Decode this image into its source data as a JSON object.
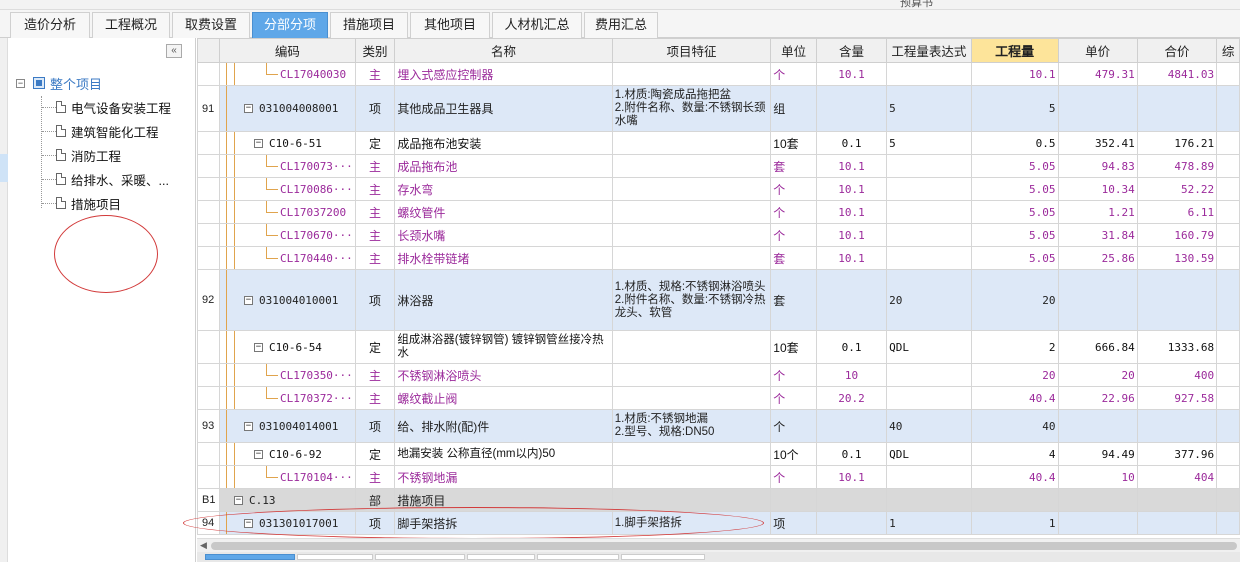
{
  "window": {
    "title": "预算书"
  },
  "tabs": [
    {
      "label": "造价分析",
      "active": false
    },
    {
      "label": "工程概况",
      "active": false
    },
    {
      "label": "取费设置",
      "active": false
    },
    {
      "label": "分部分项",
      "active": true
    },
    {
      "label": "措施项目",
      "active": false
    },
    {
      "label": "其他项目",
      "active": false
    },
    {
      "label": "人材机汇总",
      "active": false
    },
    {
      "label": "费用汇总",
      "active": false
    }
  ],
  "sidebar": {
    "collapse_label": "«",
    "root": {
      "toggle": "−",
      "label": "整个项目"
    },
    "items": [
      {
        "label": "电气设备安装工程"
      },
      {
        "label": "建筑智能化工程"
      },
      {
        "label": "消防工程"
      },
      {
        "label": "给排水、采暖、..."
      },
      {
        "label": "措施项目"
      }
    ]
  },
  "table": {
    "columns": [
      "",
      "编码",
      "类别",
      "名称",
      "项目特征",
      "单位",
      "含量",
      "工程量表达式",
      "工程量",
      "单价",
      "合价",
      "综"
    ],
    "highlight_column": "工程量",
    "rows": [
      {
        "type": "zc",
        "seq": "",
        "code": "CL17040030",
        "cat": "主",
        "name": "埋入式感应控制器",
        "feature": "",
        "unit": "个",
        "content": "10.1",
        "expr": "",
        "qty": "10.1",
        "price": "479.31",
        "total": "4841.03"
      },
      {
        "type": "qd",
        "seq": "91",
        "code": "031004008001",
        "cat": "项",
        "name": "其他成品卫生器具",
        "feature": "1.材质:陶瓷成品拖把盆\n2.附件名称、数量:不锈钢长颈水嘴",
        "unit": "组",
        "content": "",
        "expr": "5",
        "qty": "5",
        "price": "",
        "total": ""
      },
      {
        "type": "def",
        "seq": "",
        "code": "C10-6-51",
        "cat": "定",
        "name": "成品拖布池安装",
        "feature": "",
        "unit": "10套",
        "content": "0.1",
        "expr": "5",
        "qty": "0.5",
        "price": "352.41",
        "total": "176.21"
      },
      {
        "type": "zc",
        "seq": "",
        "code": "CL170073···",
        "cat": "主",
        "name": "成品拖布池",
        "feature": "",
        "unit": "套",
        "content": "10.1",
        "expr": "",
        "qty": "5.05",
        "price": "94.83",
        "total": "478.89"
      },
      {
        "type": "zc",
        "seq": "",
        "code": "CL170086···",
        "cat": "主",
        "name": "存水弯",
        "feature": "",
        "unit": "个",
        "content": "10.1",
        "expr": "",
        "qty": "5.05",
        "price": "10.34",
        "total": "52.22"
      },
      {
        "type": "zc",
        "seq": "",
        "code": "CL17037200",
        "cat": "主",
        "name": "螺纹管件",
        "feature": "",
        "unit": "个",
        "content": "10.1",
        "expr": "",
        "qty": "5.05",
        "price": "1.21",
        "total": "6.11"
      },
      {
        "type": "zc",
        "seq": "",
        "code": "CL170670···",
        "cat": "主",
        "name": "长颈水嘴",
        "feature": "",
        "unit": "个",
        "content": "10.1",
        "expr": "",
        "qty": "5.05",
        "price": "31.84",
        "total": "160.79"
      },
      {
        "type": "zc",
        "seq": "",
        "code": "CL170440···",
        "cat": "主",
        "name": "排水栓带链堵",
        "feature": "",
        "unit": "套",
        "content": "10.1",
        "expr": "",
        "qty": "5.05",
        "price": "25.86",
        "total": "130.59"
      },
      {
        "type": "qd",
        "seq": "92",
        "code": "031004010001",
        "cat": "项",
        "name": "淋浴器",
        "feature": "1.材质、规格:不锈钢淋浴喷头\n2.附件名称、数量:不锈钢冷热龙头、软管",
        "unit": "套",
        "content": "",
        "expr": "20",
        "qty": "20",
        "price": "",
        "total": ""
      },
      {
        "type": "def",
        "seq": "",
        "code": "C10-6-54",
        "cat": "定",
        "name": "组成淋浴器(镀锌钢管) 镀锌钢管丝接冷热水",
        "feature": "",
        "unit": "10套",
        "content": "0.1",
        "expr": "QDL",
        "qty": "2",
        "price": "666.84",
        "total": "1333.68"
      },
      {
        "type": "zc",
        "seq": "",
        "code": "CL170350···",
        "cat": "主",
        "name": "不锈钢淋浴喷头",
        "feature": "",
        "unit": "个",
        "content": "10",
        "expr": "",
        "qty": "20",
        "price": "20",
        "total": "400"
      },
      {
        "type": "zc",
        "seq": "",
        "code": "CL170372···",
        "cat": "主",
        "name": "螺纹截止阀",
        "feature": "",
        "unit": "个",
        "content": "20.2",
        "expr": "",
        "qty": "40.4",
        "price": "22.96",
        "total": "927.58"
      },
      {
        "type": "qd",
        "seq": "93",
        "code": "031004014001",
        "cat": "项",
        "name": "给、排水附(配)件",
        "feature": "1.材质:不锈钢地漏\n2.型号、规格:DN50",
        "unit": "个",
        "content": "",
        "expr": "40",
        "qty": "40",
        "price": "",
        "total": ""
      },
      {
        "type": "def",
        "seq": "",
        "code": "C10-6-92",
        "cat": "定",
        "name": "地漏安装 公称直径(mm以内)50",
        "feature": "",
        "unit": "10个",
        "content": "0.1",
        "expr": "QDL",
        "qty": "4",
        "price": "94.49",
        "total": "377.96"
      },
      {
        "type": "zc",
        "seq": "",
        "code": "CL170104···",
        "cat": "主",
        "name": "不锈钢地漏",
        "feature": "",
        "unit": "个",
        "content": "10.1",
        "expr": "",
        "qty": "40.4",
        "price": "10",
        "total": "404"
      },
      {
        "type": "fb",
        "seq": "B1",
        "code": "C.13",
        "cat": "部",
        "name": "措施项目",
        "feature": "",
        "unit": "",
        "content": "",
        "expr": "",
        "qty": "",
        "price": "",
        "total": ""
      },
      {
        "type": "qd",
        "seq": "94",
        "code": "031301017001",
        "cat": "项",
        "name": "脚手架搭拆",
        "feature": "1.脚手架搭拆",
        "unit": "项",
        "content": "",
        "expr": "1",
        "qty": "1",
        "price": "",
        "total": ""
      }
    ]
  },
  "colors": {
    "tab_active": "#5fa7e8",
    "row_bill": "#dde8f7",
    "row_division": "#d9d9d9",
    "material_text": "#9b2a9b",
    "header_highlight": "#fde49a",
    "annotation_red": "#d23a3a"
  }
}
